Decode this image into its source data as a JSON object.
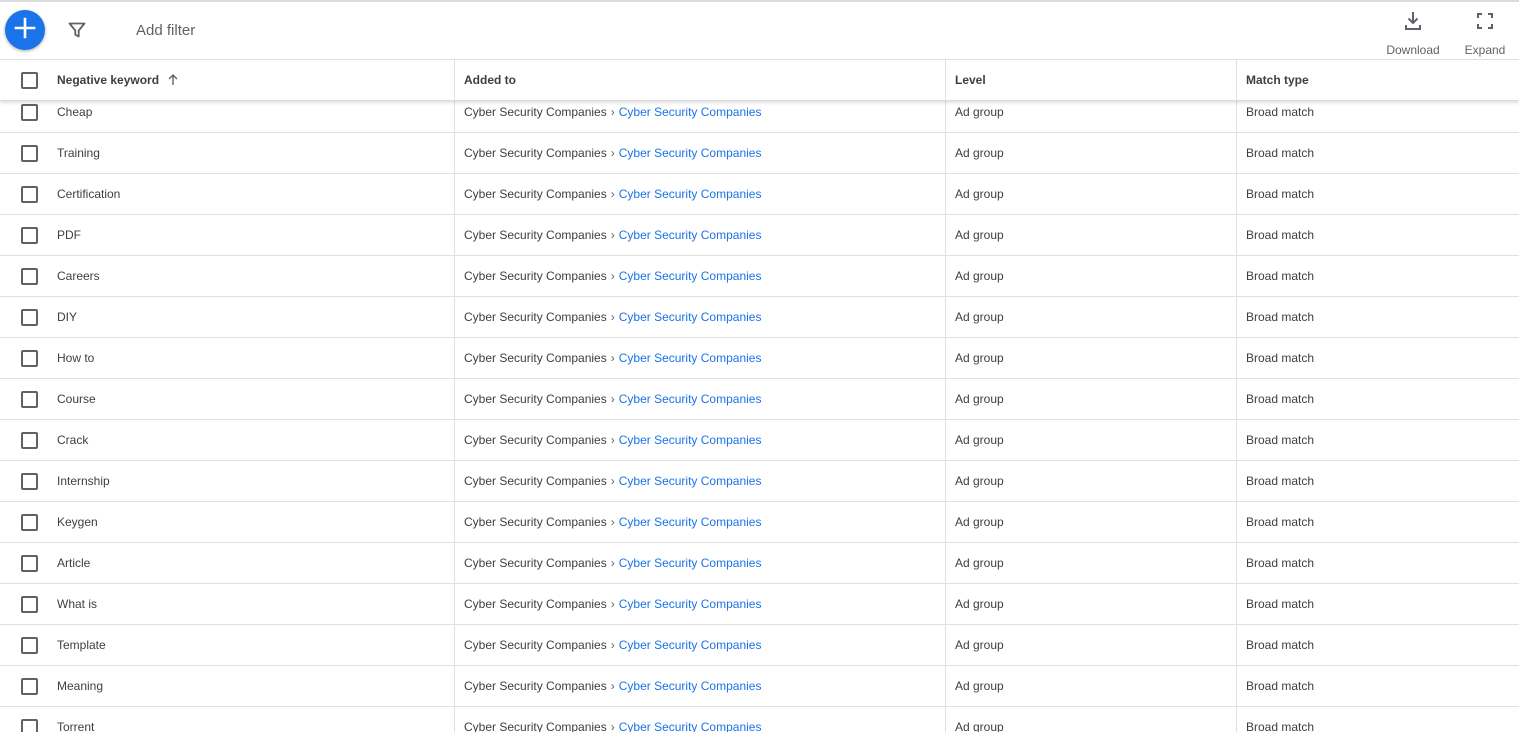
{
  "toolbar": {
    "add_filter": "Add filter",
    "download_label": "Download",
    "expand_label": "Expand",
    "accent": "#1a73e8"
  },
  "columns": {
    "keyword": "Negative keyword",
    "added_to": "Added to",
    "level": "Level",
    "match_type": "Match type"
  },
  "rows": [
    {
      "keyword": "Cheap",
      "campaign": "Cyber Security Companies",
      "ad_group": "Cyber Security Companies",
      "level": "Ad group",
      "match_type": "Broad match"
    },
    {
      "keyword": "Training",
      "campaign": "Cyber Security Companies",
      "ad_group": "Cyber Security Companies",
      "level": "Ad group",
      "match_type": "Broad match"
    },
    {
      "keyword": "Certification",
      "campaign": "Cyber Security Companies",
      "ad_group": "Cyber Security Companies",
      "level": "Ad group",
      "match_type": "Broad match"
    },
    {
      "keyword": "PDF",
      "campaign": "Cyber Security Companies",
      "ad_group": "Cyber Security Companies",
      "level": "Ad group",
      "match_type": "Broad match"
    },
    {
      "keyword": "Careers",
      "campaign": "Cyber Security Companies",
      "ad_group": "Cyber Security Companies",
      "level": "Ad group",
      "match_type": "Broad match"
    },
    {
      "keyword": "DIY",
      "campaign": "Cyber Security Companies",
      "ad_group": "Cyber Security Companies",
      "level": "Ad group",
      "match_type": "Broad match"
    },
    {
      "keyword": "How to",
      "campaign": "Cyber Security Companies",
      "ad_group": "Cyber Security Companies",
      "level": "Ad group",
      "match_type": "Broad match"
    },
    {
      "keyword": "Course",
      "campaign": "Cyber Security Companies",
      "ad_group": "Cyber Security Companies",
      "level": "Ad group",
      "match_type": "Broad match"
    },
    {
      "keyword": "Crack",
      "campaign": "Cyber Security Companies",
      "ad_group": "Cyber Security Companies",
      "level": "Ad group",
      "match_type": "Broad match"
    },
    {
      "keyword": "Internship",
      "campaign": "Cyber Security Companies",
      "ad_group": "Cyber Security Companies",
      "level": "Ad group",
      "match_type": "Broad match"
    },
    {
      "keyword": "Keygen",
      "campaign": "Cyber Security Companies",
      "ad_group": "Cyber Security Companies",
      "level": "Ad group",
      "match_type": "Broad match"
    },
    {
      "keyword": "Article",
      "campaign": "Cyber Security Companies",
      "ad_group": "Cyber Security Companies",
      "level": "Ad group",
      "match_type": "Broad match"
    },
    {
      "keyword": "What is",
      "campaign": "Cyber Security Companies",
      "ad_group": "Cyber Security Companies",
      "level": "Ad group",
      "match_type": "Broad match"
    },
    {
      "keyword": "Template",
      "campaign": "Cyber Security Companies",
      "ad_group": "Cyber Security Companies",
      "level": "Ad group",
      "match_type": "Broad match"
    },
    {
      "keyword": "Meaning",
      "campaign": "Cyber Security Companies",
      "ad_group": "Cyber Security Companies",
      "level": "Ad group",
      "match_type": "Broad match"
    },
    {
      "keyword": "Torrent",
      "campaign": "Cyber Security Companies",
      "ad_group": "Cyber Security Companies",
      "level": "Ad group",
      "match_type": "Broad match"
    }
  ]
}
